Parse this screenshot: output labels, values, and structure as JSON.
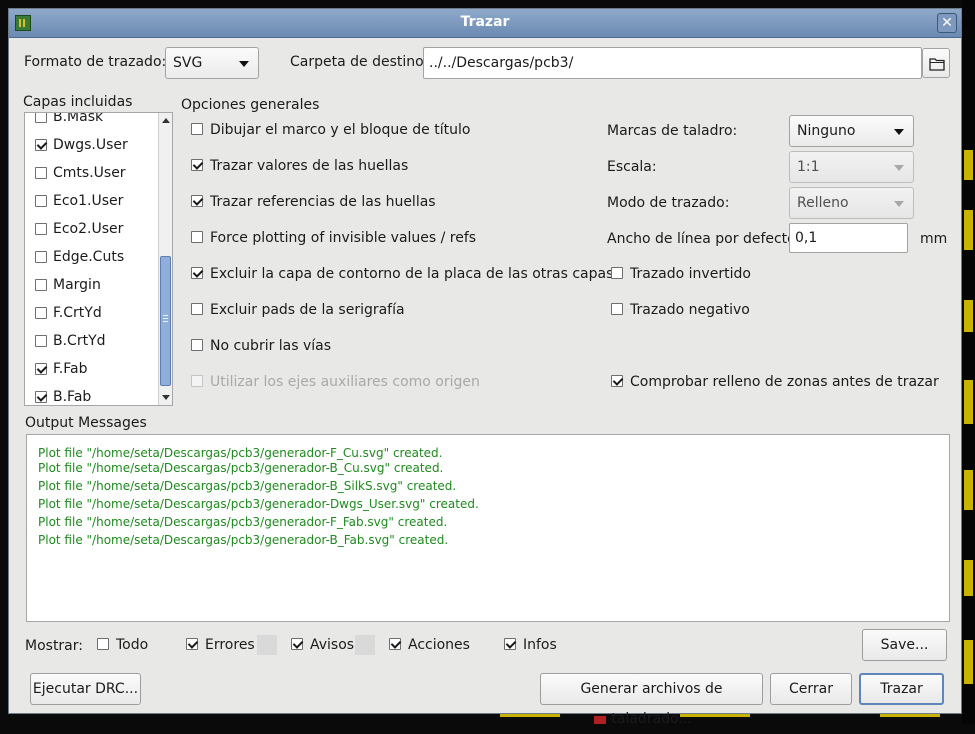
{
  "window": {
    "title": "Trazar"
  },
  "top": {
    "format_label": "Formato de trazado:",
    "format_value": "SVG",
    "folder_label": "Carpeta de destino:",
    "folder_value": "../../Descargas/pcb3/"
  },
  "layers": {
    "label": "Capas incluidas",
    "items": [
      {
        "label": "B.Mask",
        "checked": false
      },
      {
        "label": "Dwgs.User",
        "checked": true
      },
      {
        "label": "Cmts.User",
        "checked": false
      },
      {
        "label": "Eco1.User",
        "checked": false
      },
      {
        "label": "Eco2.User",
        "checked": false
      },
      {
        "label": "Edge.Cuts",
        "checked": false
      },
      {
        "label": "Margin",
        "checked": false
      },
      {
        "label": "F.CrtYd",
        "checked": false
      },
      {
        "label": "B.CrtYd",
        "checked": false
      },
      {
        "label": "F.Fab",
        "checked": true
      },
      {
        "label": "B.Fab",
        "checked": true
      }
    ]
  },
  "general": {
    "label": "Opciones generales",
    "options": [
      {
        "label": "Dibujar el marco y el bloque de título",
        "checked": false,
        "disabled": false
      },
      {
        "label": "Trazar valores de las huellas",
        "checked": true,
        "disabled": false
      },
      {
        "label": "Trazar referencias de las huellas",
        "checked": true,
        "disabled": false
      },
      {
        "label": "Force plotting of invisible values / refs",
        "checked": false,
        "disabled": false
      },
      {
        "label": "Excluir la capa de contorno de la placa de las otras capas",
        "checked": true,
        "disabled": false
      },
      {
        "label": "Excluir pads de la serigrafía",
        "checked": false,
        "disabled": false
      },
      {
        "label": "No cubrir las vías",
        "checked": false,
        "disabled": false
      },
      {
        "label": "Utilizar los ejes auxiliares como origen",
        "checked": false,
        "disabled": true
      }
    ]
  },
  "right": {
    "drill_label": "Marcas de taladro:",
    "drill_value": "Ninguno",
    "scale_label": "Escala:",
    "scale_value": "1:1",
    "mode_label": "Modo de trazado:",
    "mode_value": "Relleno",
    "width_label": "Ancho de línea por defecto:",
    "width_value": "0,1",
    "width_unit": "mm",
    "invert_label": "Trazado invertido",
    "invert_checked": false,
    "negative_label": "Trazado negativo",
    "negative_checked": false,
    "zones_label": "Comprobar relleno de zonas antes de trazar",
    "zones_checked": true
  },
  "output": {
    "label": "Output Messages",
    "messages": [
      "Plot file \"/home/seta/Descargas/pcb3/generador-F_Cu.svg\" created.",
      "Plot file \"/home/seta/Descargas/pcb3/generador-B_Cu.svg\" created.",
      "Plot file \"/home/seta/Descargas/pcb3/generador-B_SilkS.svg\" created.",
      "Plot file \"/home/seta/Descargas/pcb3/generador-Dwgs_User.svg\" created.",
      "Plot file \"/home/seta/Descargas/pcb3/generador-F_Fab.svg\" created.",
      "Plot file \"/home/seta/Descargas/pcb3/generador-B_Fab.svg\" created."
    ],
    "message_color": "#1f8a1f"
  },
  "filters": {
    "show_label": "Mostrar:",
    "all_label": "Todo",
    "all_checked": false,
    "errors_label": "Errores",
    "errors_checked": true,
    "warnings_label": "Avisos",
    "warnings_checked": true,
    "actions_label": "Acciones",
    "actions_checked": true,
    "infos_label": "Infos",
    "infos_checked": true,
    "save_label": "Save..."
  },
  "buttons": {
    "drc": "Ejecutar DRC...",
    "drill": "Generar archivos de taladrado...",
    "close": "Cerrar",
    "plot": "Trazar"
  },
  "icons": {
    "close": "close-icon",
    "folder": "folder-icon",
    "app": "kicad-app-icon"
  }
}
